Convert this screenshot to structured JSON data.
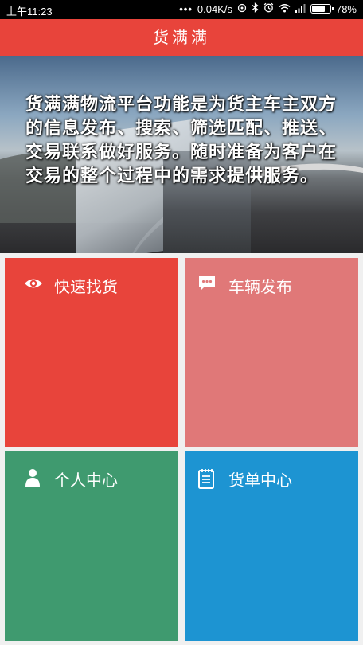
{
  "status_bar": {
    "time": "上午11:23",
    "network_speed": "0.04K/s",
    "battery": "78%",
    "battery_level": 0.78,
    "icons": [
      "dots-icon",
      "hotspot-icon",
      "bluetooth-icon",
      "alarm-icon",
      "signal-icon",
      "wifi-icon",
      "battery-icon"
    ]
  },
  "app_bar": {
    "title": "货满满"
  },
  "banner": {
    "text": "货满满物流平台功能是为货主车主双方的信息发布、搜索、筛选匹配、推送、交易联系做好服务。随时准备为客户在交易的整个过程中的需求提供服务。",
    "dots_count": 5,
    "active_dot": 3
  },
  "tiles": [
    {
      "label": "快速找货",
      "icon": "eye-icon",
      "color": "#e8443b"
    },
    {
      "label": "车辆发布",
      "icon": "chat-bubble-icon",
      "color": "#e07878"
    },
    {
      "label": "个人中心",
      "icon": "person-icon",
      "color": "#3f9a6f"
    },
    {
      "label": "货单中心",
      "icon": "notepad-icon",
      "color": "#1d94d2"
    }
  ]
}
